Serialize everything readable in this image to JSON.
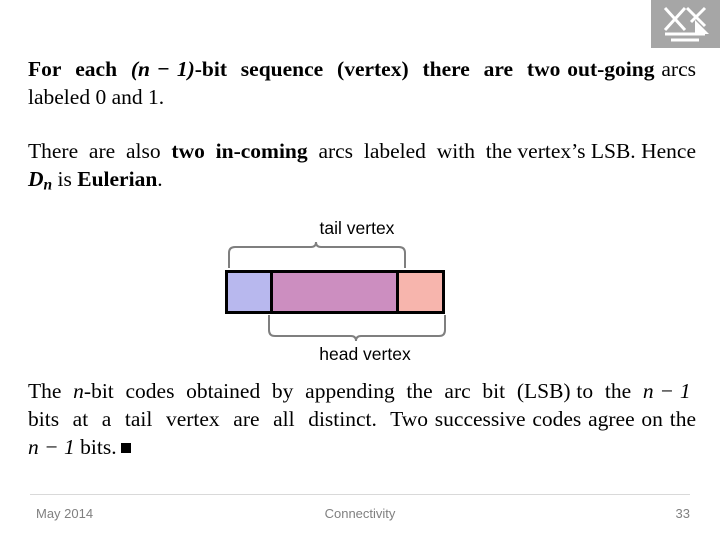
{
  "logo": {
    "name": "institution-logo"
  },
  "body": {
    "paragraph1_html": "For  each  <i>(n − 1)</i>-bit  sequence  (vertex)  there  are  <b>two out-going</b> arcs labeled 0 and 1.",
    "paragraph1_plain": "For each (n − 1)-bit sequence (vertex) there are two out-going arcs labeled 0 and 1.",
    "paragraph2_plain": "There are also two in-coming arcs labeled with the vertex's LSB. Hence D_n is Eulerian.",
    "paragraph3_plain": "The n-bit codes obtained by appending the arc bit (LSB) to the n − 1 bits at a tail vertex are all distinct. Two successive codes agree on the n − 1 bits."
  },
  "diagram": {
    "tail_label": "tail vertex",
    "head_label": "head vertex",
    "segments": [
      {
        "name": "msb-cell",
        "color": "#b8b8ee"
      },
      {
        "name": "middle-cell",
        "color": "#cc8ec0"
      },
      {
        "name": "lsb-cell",
        "color": "#f7b5ad"
      }
    ],
    "brace_color": "#7f7f7f"
  },
  "footer": {
    "date": "May 2014",
    "section": "Connectivity",
    "page": "33"
  }
}
